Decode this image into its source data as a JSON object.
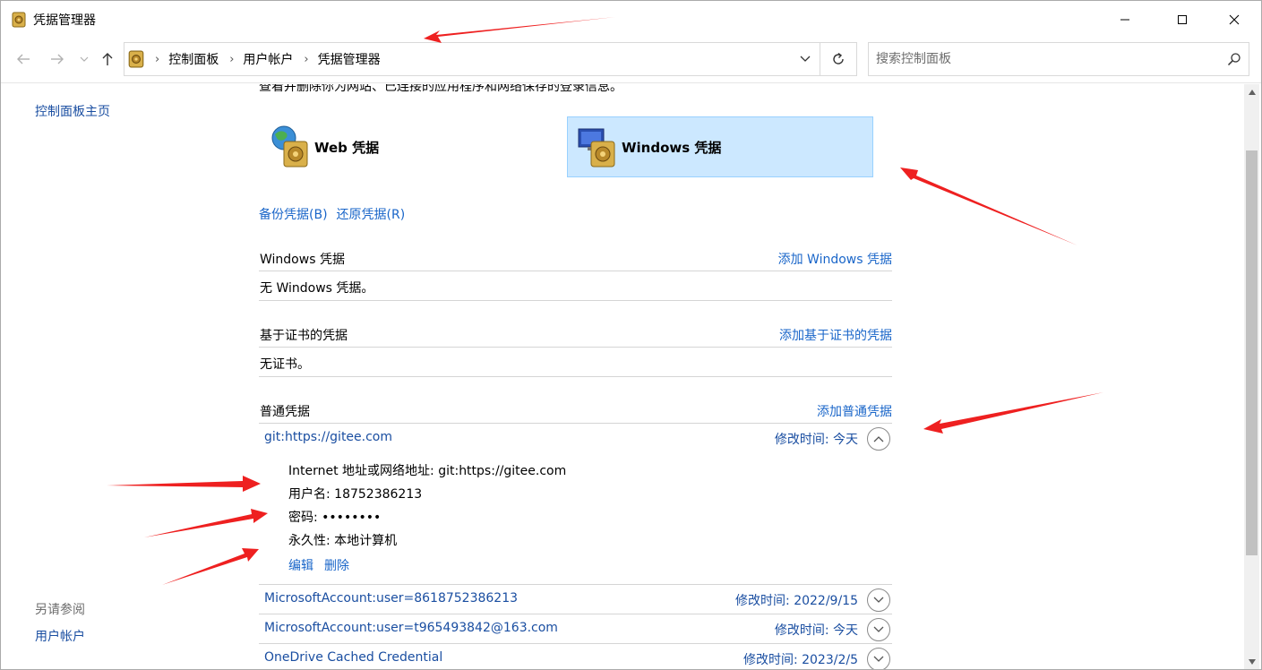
{
  "window": {
    "title": "凭据管理器",
    "controls": {
      "minimize": "—",
      "maximize": "☐",
      "close": "✕"
    }
  },
  "address": {
    "crumbs": [
      "控制面板",
      "用户帐户",
      "凭据管理器"
    ],
    "search_placeholder": "搜索控制面板"
  },
  "left_panel": {
    "home_link": "控制面板主页",
    "see_also": "另请参阅",
    "user_accounts_link": "用户帐户"
  },
  "main": {
    "intro": "查看并删除你为网站、已连接的应用程序和网络保存的登录信息。",
    "tiles": {
      "web": "Web 凭据",
      "windows": "Windows 凭据"
    },
    "backup_link": "备份凭据(B)",
    "restore_link": "还原凭据(R)",
    "sections": {
      "windows": {
        "title": "Windows 凭据",
        "add": "添加 Windows 凭据",
        "empty": "无 Windows 凭据。"
      },
      "cert": {
        "title": "基于证书的凭据",
        "add": "添加基于证书的凭据",
        "empty": "无证书。"
      },
      "generic": {
        "title": "普通凭据",
        "add": "添加普通凭据"
      }
    },
    "credentials": [
      {
        "name": "git:https://gitee.com",
        "modified": "修改时间:  今天",
        "expanded": true,
        "details": {
          "address": "Internet 地址或网络地址:  git:https://gitee.com",
          "username": "用户名:  18752386213",
          "password": "密码:  ••••••••",
          "persistence": "永久性:  本地计算机"
        },
        "edit": "编辑",
        "delete": "删除"
      },
      {
        "name": "MicrosoftAccount:user=8618752386213",
        "modified": "修改时间:  2022/9/15",
        "expanded": false
      },
      {
        "name": "MicrosoftAccount:user=t965493842@163.com",
        "modified": "修改时间:  今天",
        "expanded": false
      },
      {
        "name": "OneDrive Cached Credential",
        "modified": "修改时间:  2023/2/5",
        "expanded": false
      }
    ]
  },
  "colors": {
    "link": "#1a66c9",
    "selected_tile": "#cce8ff",
    "annotation_arrow": "#ee2020"
  }
}
